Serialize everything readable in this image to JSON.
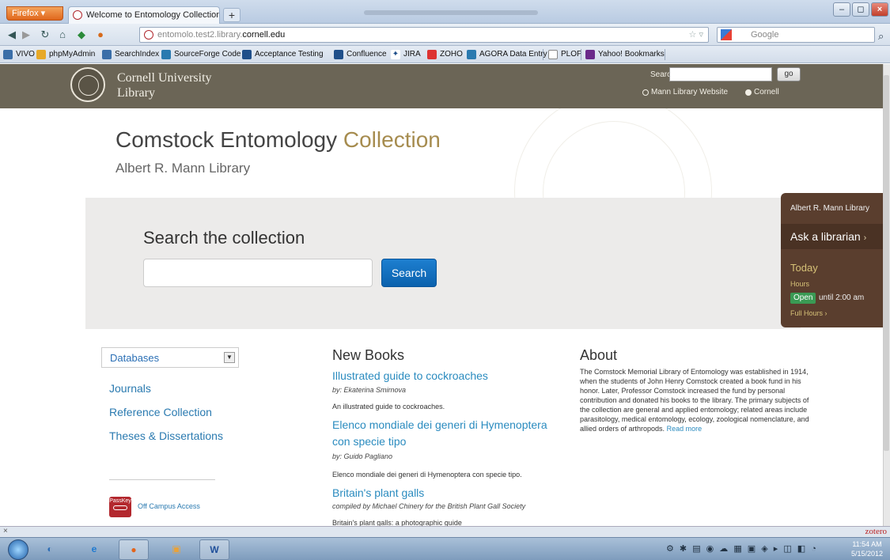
{
  "browser": {
    "firefox_button": "Firefox",
    "tab_title": "Welcome to Entomology Collection | En...",
    "new_tab": "+",
    "url_prefix": "entomolo.test2.library.",
    "url_domain": "cornell.edu",
    "search_engine": "Google",
    "bookmarks": [
      "VIVO",
      "phpMyAdmin",
      "SearchIndex",
      "SourceForge Code",
      "Acceptance Testing",
      "Confluence",
      "JIRA",
      "ZOHO",
      "AGORA Data Entry",
      "PLOP",
      "Yahoo! Bookmarks"
    ]
  },
  "header": {
    "org_line1": "Cornell University",
    "org_line2": "Library",
    "search_label": "Search",
    "go_label": "go",
    "radio_mann": "Mann Library Website",
    "radio_cornell": "Cornell"
  },
  "page": {
    "title_main": "Comstock Entomology",
    "title_accent": "Collection",
    "subtitle": "Albert R. Mann Library",
    "search_heading": "Search the collection",
    "search_button": "Search"
  },
  "hours_card": {
    "library": "Albert R. Mann Library",
    "ask": "Ask a librarian",
    "today": "Today",
    "hours": "Hours",
    "open": "Open",
    "until": "until 2:00 am",
    "full_hours": "Full Hours"
  },
  "sidebar": {
    "select_value": "Databases",
    "links": [
      "Journals",
      "Reference Collection",
      "Theses & Dissertations"
    ],
    "passkey": "PassKey",
    "off_campus": "Off Campus Access"
  },
  "new_books": {
    "heading": "New Books",
    "books": [
      {
        "title": "Illustrated guide to cockroaches",
        "by": "by: Ekaterina Smirnova",
        "desc": "An illustrated guide to cockroaches."
      },
      {
        "title": "Elenco mondiale dei generi di Hymenoptera con specie tipo",
        "by": "by: Guido Pagliano",
        "desc": "Elenco mondiale dei generi di Hymenoptera con specie tipo."
      },
      {
        "title": "Britain's plant galls",
        "by": "compiled by Michael Chinery for the British Plant Gall Society",
        "desc": "Britain's plant galls: a photographic guide"
      }
    ]
  },
  "about": {
    "heading": "About",
    "text": "The Comstock Memorial Library of Entomology was established in 1914, when the students of John Henry Comstock created a book fund in his honor. Later, Professor Comstock increased the fund by personal contribution and donated his books to the library. The primary subjects of the collection are general and applied entomology; related areas include parasitology, medical entomology, ecology, zoological nomenclature, and allied orders of arthropods.",
    "read_more": "Read more"
  },
  "statusbar": {
    "close": "×",
    "zotero": "zotero"
  },
  "taskbar": {
    "word_label": "W",
    "time": "11:54 AM",
    "date": "5/15/2012"
  },
  "colors": {
    "header_bg": "#6b6556",
    "accent_gold": "#a68c4f",
    "link_blue": "#2a8bbf",
    "search_button": "#0b61ad",
    "hours_card": "#5a3e2e",
    "open_badge": "#3a9a54"
  }
}
